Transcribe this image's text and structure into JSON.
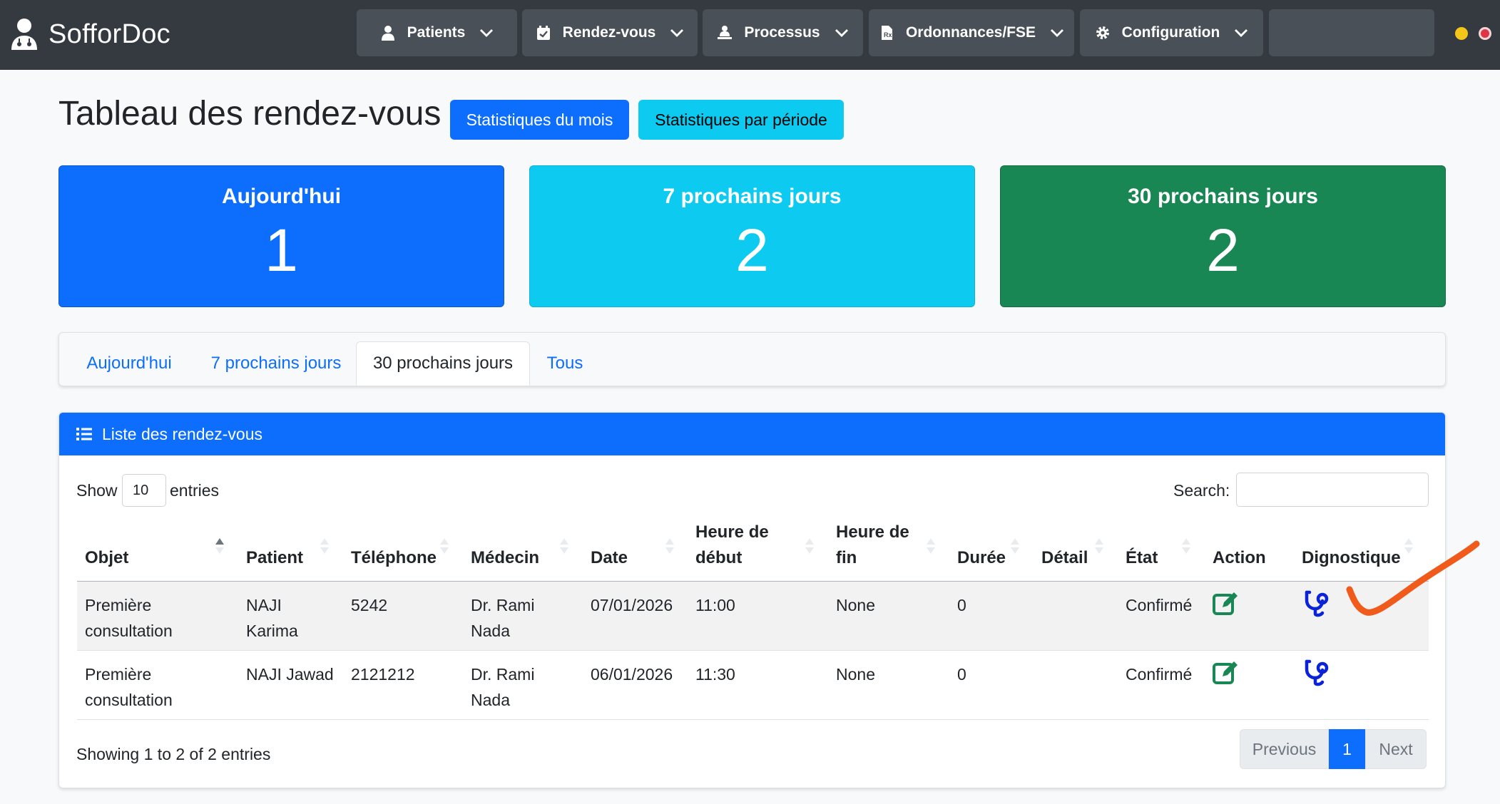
{
  "app": {
    "brand": "SofforDoc"
  },
  "nav": [
    {
      "label": "Patients",
      "icon": "user-icon"
    },
    {
      "label": "Rendez-vous",
      "icon": "calendar-check-icon"
    },
    {
      "label": "Processus",
      "icon": "user-process-icon"
    },
    {
      "label": "Ordonnances/FSE",
      "icon": "prescription-file-icon"
    },
    {
      "label": "Configuration",
      "icon": "gear-icon"
    }
  ],
  "status_colors": {
    "yellow": "#f5c518",
    "red": "#dc3545"
  },
  "header": {
    "title": "Tableau des rendez-vous",
    "btn_month": "Statistiques du mois",
    "btn_period": "Statistiques par période"
  },
  "stats": [
    {
      "title": "Aujourd'hui",
      "value": "1",
      "color": "#0d6efd"
    },
    {
      "title": "7 prochains jours",
      "value": "2",
      "color": "#0dcaf0"
    },
    {
      "title": "30 prochains jours",
      "value": "2",
      "color": "#198754"
    }
  ],
  "tabs": [
    {
      "label": "Aujourd'hui"
    },
    {
      "label": "7 prochains jours"
    },
    {
      "label": "30 prochains jours",
      "active": true
    },
    {
      "label": "Tous"
    }
  ],
  "list": {
    "title": "Liste des rendez-vous",
    "show_label": "Show",
    "entries_value": "10",
    "entries_label": "entries",
    "search_label": "Search:",
    "search_value": "",
    "columns": {
      "objet": "Objet",
      "patient": "Patient",
      "telephone": "Téléphone",
      "medecin": "Médecin",
      "date": "Date",
      "heure_debut_1": "Heure de",
      "heure_debut_2": "début",
      "heure_fin_1": "Heure de",
      "heure_fin_2": "fin",
      "duree": "Durée",
      "detail": "Détail",
      "etat": "État",
      "action": "Action",
      "diagnostique": "Dignostique"
    },
    "rows": [
      {
        "objet_1": "Première",
        "objet_2": "consultation",
        "patient_1": "NAJI",
        "patient_2": "Karima",
        "telephone": "5242",
        "medecin_1": "Dr. Rami",
        "medecin_2": "Nada",
        "date": "07/01/2026",
        "heure_debut": "11:00",
        "heure_fin": "None",
        "duree": "0",
        "detail": "",
        "etat": "Confirmé"
      },
      {
        "objet_1": "Première",
        "objet_2": "consultation",
        "patient_1": "NAJI Jawad",
        "patient_2": "",
        "telephone": "2121212",
        "medecin_1": "Dr. Rami",
        "medecin_2": "Nada",
        "date": "06/01/2026",
        "heure_debut": "11:30",
        "heure_fin": "None",
        "duree": "0",
        "detail": "",
        "etat": "Confirmé"
      }
    ],
    "info": "Showing 1 to 2 of 2 entries",
    "pagination": {
      "previous": "Previous",
      "page": "1",
      "next": "Next"
    }
  }
}
